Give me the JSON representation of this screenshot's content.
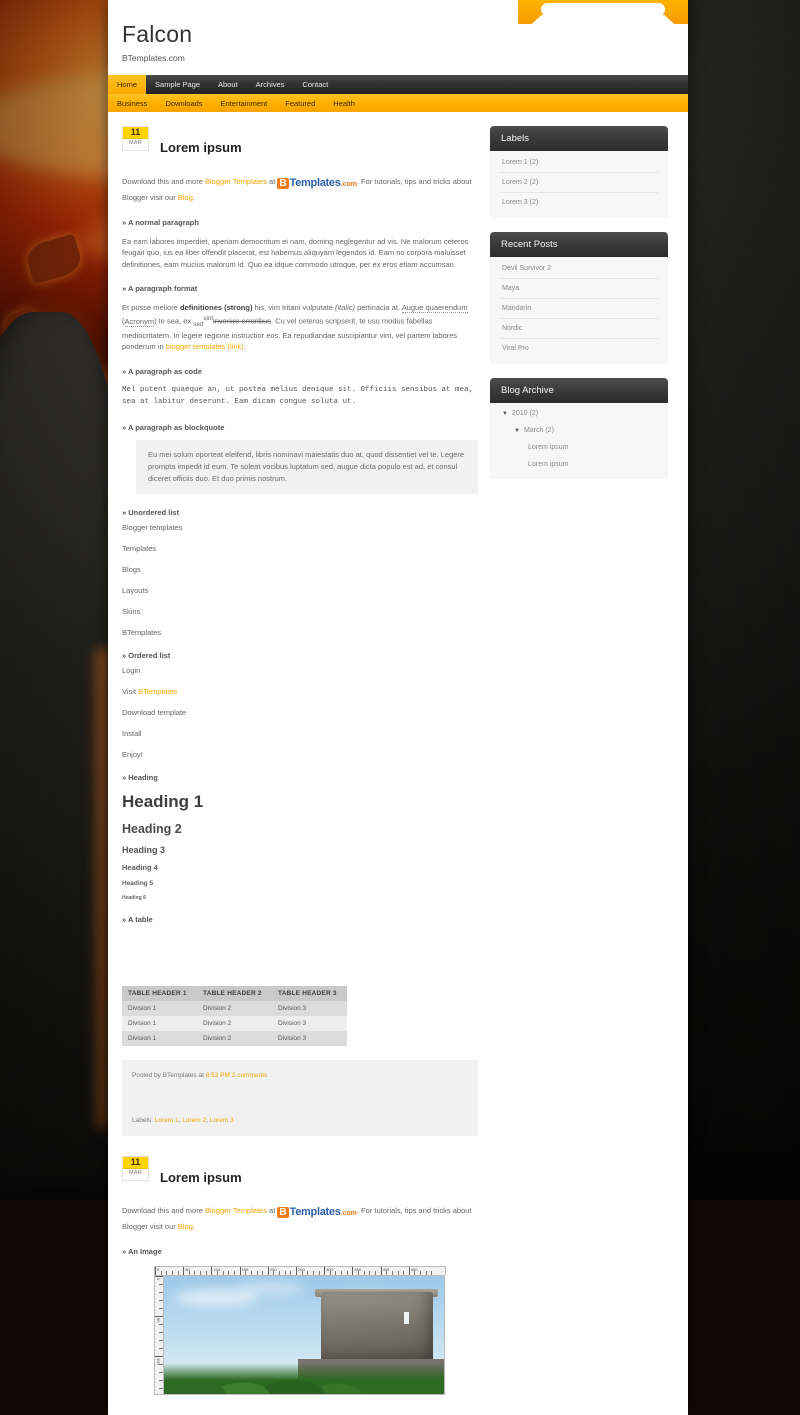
{
  "search": {
    "placeholder": "",
    "value": ""
  },
  "header": {
    "title": "Falcon",
    "description": "BTemplates.com"
  },
  "main_nav": [
    {
      "label": "Home",
      "active": true
    },
    {
      "label": "Sample Page",
      "active": false
    },
    {
      "label": "About",
      "active": false
    },
    {
      "label": "Archives",
      "active": false
    },
    {
      "label": "Contact",
      "active": false
    }
  ],
  "sub_nav": [
    {
      "label": "Business"
    },
    {
      "label": "Downloads"
    },
    {
      "label": "Entertainment"
    },
    {
      "label": "Featured"
    },
    {
      "label": "Health"
    }
  ],
  "post1": {
    "date_day": "11",
    "date_month": "MAR",
    "title": "Lorem ipsum",
    "intro_a": "Download this and more ",
    "intro_link1": "Blogger Templates",
    "intro_b": " at ",
    "logo_b": "B",
    "logo_templates": "Templates",
    "logo_com": ".com",
    "intro_c": ". For tutorials, tips and tricks about Blogger visit our ",
    "intro_link2": "Blog",
    "intro_d": ".",
    "h_normal": "» A normal paragraph",
    "normal_text": "Ea eam labores imperdiet, aperiam democritum ei nam, doming neglegentur ad vis. Ne malorum ceteros feugait quo, ius ea liber offendit placerat, est habemus aliquyam legendos id. Eam no corpora maluisset definitiones, eam mucius malorum id. Quo ea idque commodo utroque, per ex eros etiam accumsan.",
    "h_format": "» A paragraph format",
    "fmt_1": "Et posse meliore ",
    "fmt_strong": "definitiones (strong)",
    "fmt_2": " his, vim tritani vulputate ",
    "fmt_italic": "(italic)",
    "fmt_3": " pertinacia at. ",
    "fmt_acronym1": "Augue quaerendum",
    "fmt_4": " (",
    "fmt_acronym2": "Acronym",
    "fmt_5": ") te sea, ex ",
    "fmt_sub": "sed",
    "fmt_sup": "sint",
    "fmt_strike": "invenire erroribus",
    "fmt_6": ". Cu vel ceteros scripserit, te usu modus fabellas mediocritatem. In legere regione instructior eos. Ea repudiandae suscipiantur vim, vel partem labores ponderum in ",
    "fmt_link": "blogger templates (link)",
    "fmt_7": ".",
    "h_code": "» A paragraph as code",
    "code_text": "Mel putent quaeque an, ut postea melius denique sit. Officiis sensibus at mea,\nsea at labitur deserunt. Eam dicam congue soluta ut.",
    "h_quote": "» A paragraph as blockquote",
    "quote_text": "Eu mei solum oporteat eleifend, libris nominavi maiestatis duo at, quod dissentiet vel te. Legere prompta impedit id eum. Te soleat vocibus luptatum sed, augue dicta populo est ad, et consul diceret officiis duo. Et duo primis nostrum.",
    "h_ul": "» Unordered list",
    "ul_items": [
      "Blogger templates",
      "Templates",
      "Blogs",
      "Layouts",
      "Skins",
      "BTemplates"
    ],
    "h_ol": "» Ordered list",
    "ol_items": [
      {
        "text": "Login",
        "link": ""
      },
      {
        "pre": "Visit ",
        "link": "BTemplates",
        "text": ""
      },
      {
        "text": "Download template",
        "link": ""
      },
      {
        "text": "Install",
        "link": ""
      },
      {
        "text": "Enjoy!",
        "link": ""
      }
    ],
    "h_heading": "» Heading",
    "heading1": "Heading 1",
    "heading2": "Heading 2",
    "heading3": "Heading 3",
    "heading4": "Heading 4",
    "heading5": "Heading 5",
    "heading6": "Heading 6",
    "h_table": "» A table",
    "table": {
      "headers": [
        "TABLE HEADER 1",
        "TABLE HEADER 2",
        "TABLE HEADER 3"
      ],
      "rows": [
        [
          "Division 1",
          "Division 2",
          "Division 3"
        ],
        [
          "Division 1",
          "Division 2",
          "Division 3"
        ],
        [
          "Division 1",
          "Division 2",
          "Division 3"
        ]
      ]
    },
    "posted_prefix": "Posted by BTemplates at ",
    "posted_time": "8:53 PM",
    "comments": "2 comments",
    "labels_prefix": "Labels: ",
    "labels": [
      "Lorem 1",
      "Lorem 2",
      "Lorem 3"
    ]
  },
  "post2": {
    "date_day": "11",
    "date_month": "MAR",
    "title": "Lorem ipsum",
    "intro_a": "Download this and more ",
    "intro_link1": "Blogger Templates",
    "intro_b": " at ",
    "logo_b": "B",
    "logo_templates": "Templates",
    "logo_com": ".com",
    "intro_c": ". For tutorials, tips and tricks about Blogger visit our ",
    "intro_link2": "Blog",
    "intro_d": ".",
    "h_image": "» An Image",
    "ruler_labels": [
      "0",
      "50",
      "100",
      "150",
      "200",
      "250",
      "300",
      "350",
      "400",
      "450"
    ],
    "ruler_v_labels": [
      "0",
      "50",
      "100"
    ]
  },
  "sidebar": {
    "labels_widget": {
      "title": "Labels",
      "items": [
        "Lorem 1 (2)",
        "Lorem 2 (2)",
        "Lorem 3 (2)"
      ]
    },
    "recent_widget": {
      "title": "Recent Posts",
      "items": [
        "Devil Survivor 2",
        "Maya",
        "Mandarin",
        "Nordic",
        "Viral Pro"
      ]
    },
    "archive_widget": {
      "title": "Blog Archive",
      "items": [
        {
          "label": "2010 (2)",
          "level": 1,
          "arrow": "▼"
        },
        {
          "label": "March (2)",
          "level": 2,
          "arrow": "▼"
        },
        {
          "label": "Lorem ipsum",
          "level": 3,
          "arrow": ""
        },
        {
          "label": "Lorem ipsum",
          "level": 3,
          "arrow": ""
        }
      ]
    }
  },
  "colors": {
    "accent_yellow": "#fdb000",
    "nav_dark": "#333333",
    "link": "#f0a400",
    "logo_orange": "#f07c1a",
    "logo_blue": "#2b5fa8"
  }
}
